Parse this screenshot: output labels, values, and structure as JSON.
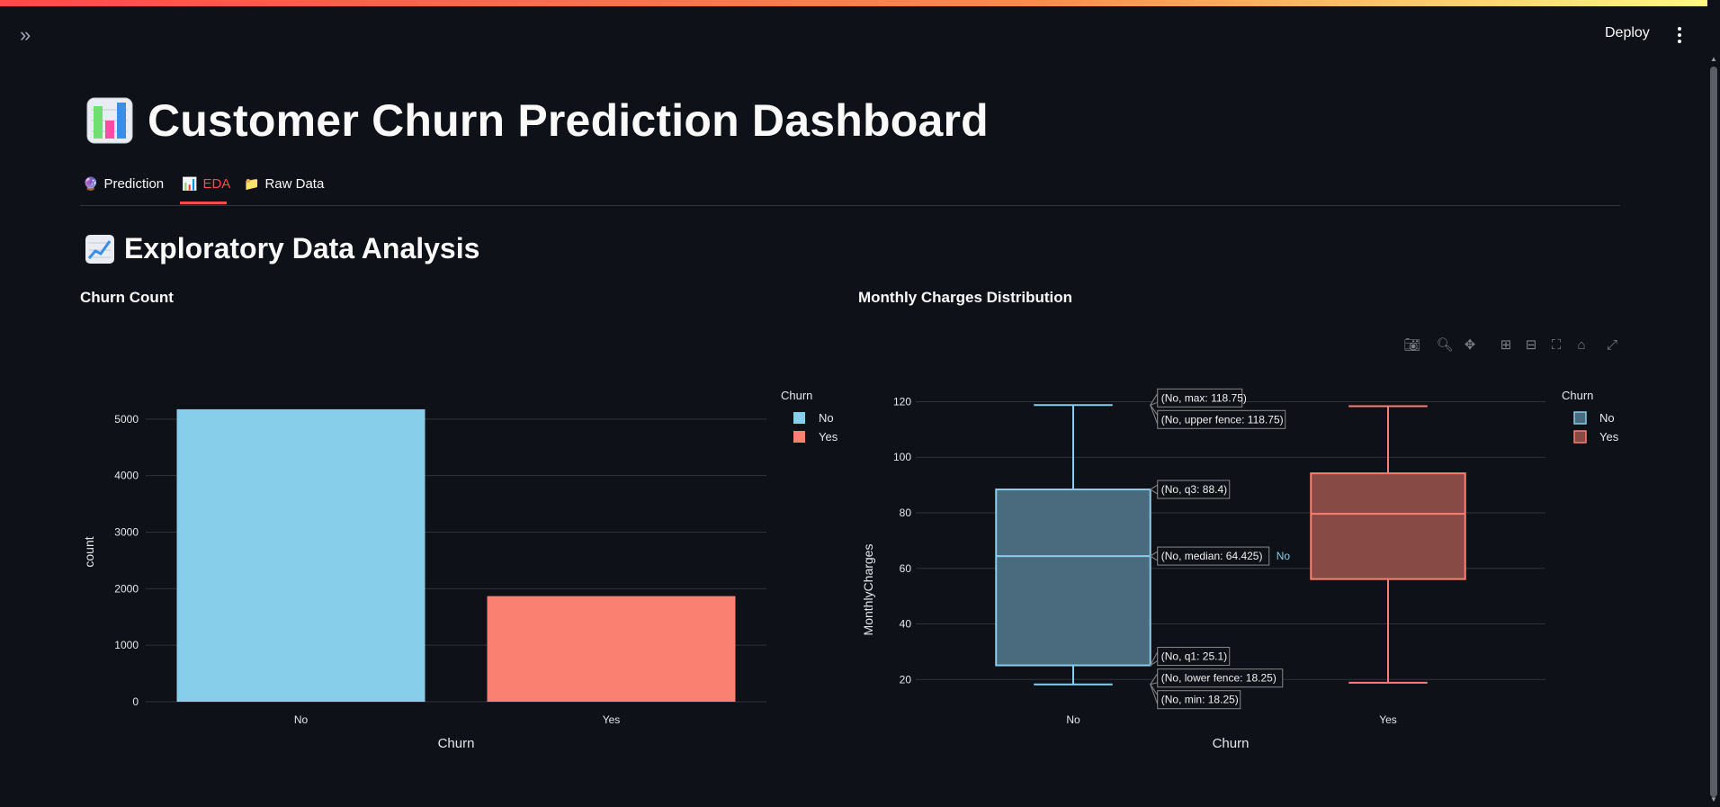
{
  "header": {
    "deploy_label": "Deploy"
  },
  "page": {
    "title": "Customer Churn Prediction Dashboard"
  },
  "tabs": [
    {
      "icon": "🔮",
      "label": "Prediction",
      "active": false
    },
    {
      "icon": "📊",
      "label": "EDA",
      "active": true
    },
    {
      "icon": "📁",
      "label": "Raw Data",
      "active": false
    }
  ],
  "section": {
    "icon": "📈",
    "title": "Exploratory Data Analysis"
  },
  "colors": {
    "no": "#87ceeb",
    "yes": "#fa8072",
    "accent": "#ff4b4b",
    "background": "#0e1117"
  },
  "chart_data": [
    {
      "type": "bar",
      "title": "Churn Count",
      "categories": [
        "No",
        "Yes"
      ],
      "values": [
        5174,
        1869
      ],
      "xlabel": "Churn",
      "ylabel": "count",
      "ylim": [
        0,
        5300
      ],
      "yticks": [
        0,
        1000,
        2000,
        3000,
        4000,
        5000
      ],
      "legend": {
        "title": "Churn",
        "entries": [
          "No",
          "Yes"
        ],
        "placement": "top-right"
      },
      "grid": true
    },
    {
      "type": "box",
      "title": "Monthly Charges Distribution",
      "categories": [
        "No",
        "Yes"
      ],
      "series": [
        {
          "name": "No",
          "min": 18.25,
          "lower_fence": 18.25,
          "q1": 25.1,
          "median": 64.425,
          "q3": 88.4,
          "upper_fence": 118.75,
          "max": 118.75
        },
        {
          "name": "Yes",
          "min": 18.85,
          "lower_fence": 18.85,
          "q1": 56.15,
          "median": 79.65,
          "q3": 94.2,
          "upper_fence": 118.35,
          "max": 118.35
        }
      ],
      "xlabel": "Churn",
      "ylabel": "MonthlyCharges",
      "ylim": [
        12,
        125
      ],
      "yticks": [
        20,
        40,
        60,
        80,
        100,
        120
      ],
      "legend": {
        "title": "Churn",
        "entries": [
          "No",
          "Yes"
        ],
        "placement": "top-right"
      },
      "hover_labels": [
        "(No, max: 118.75)",
        "(No, upper fence: 118.75)",
        "(No, q3: 88.4)",
        "(No, median: 64.425)",
        "(No, q1: 25.1)",
        "(No, lower fence: 18.25)",
        "(No, min: 18.25)"
      ],
      "hover_trace_label": "No",
      "grid": true
    }
  ],
  "toolbar": [
    "camera-icon",
    "zoom-icon",
    "pan-icon",
    "zoom-in-icon",
    "zoom-out-icon",
    "autoscale-icon",
    "home-icon",
    "fullscreen-icon"
  ]
}
